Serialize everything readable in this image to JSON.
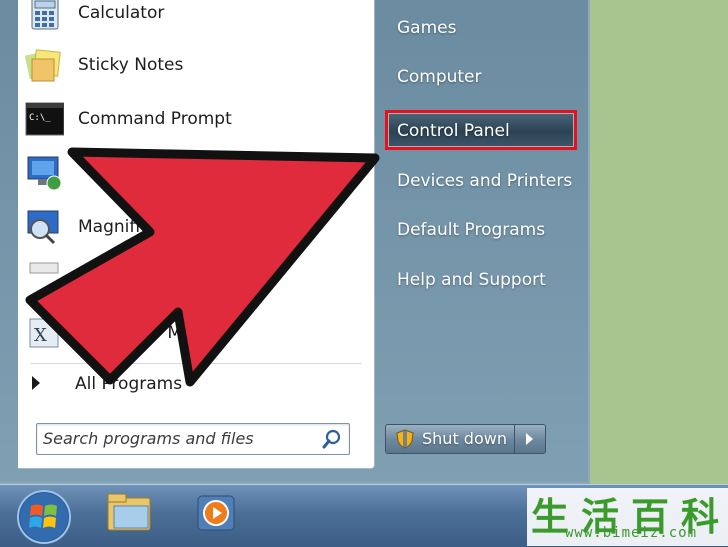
{
  "programs": [
    {
      "label": "Calculator",
      "icon": "calculator-icon"
    },
    {
      "label": "Sticky Notes",
      "icon": "sticky-notes-icon"
    },
    {
      "label": "Command Prompt",
      "icon": "command-prompt-icon"
    },
    {
      "label": "",
      "icon": "remote-desktop-icon"
    },
    {
      "label": "Magnifier",
      "icon": "magnifier-icon"
    },
    {
      "label": "",
      "icon": "paint-icon"
    },
    {
      "label": "Character Map",
      "icon": "character-map-icon"
    }
  ],
  "all_programs": "All Programs",
  "search": {
    "placeholder": "Search programs and files"
  },
  "right_pane": {
    "games": "Games",
    "computer": "Computer",
    "control_panel": "Control Panel",
    "devices_printers": "Devices and Printers",
    "default_programs": "Default Programs",
    "help_support": "Help and Support"
  },
  "shutdown": {
    "label": "Shut down"
  },
  "taskbar": {
    "items": [
      "start-orb-icon",
      "windows-explorer-icon",
      "media-player-icon"
    ]
  },
  "highlight_color": "#e8101c",
  "arrow_color": "#e02b3c",
  "watermark": {
    "title": "生活百科",
    "url": "www.bimeiz.com"
  }
}
